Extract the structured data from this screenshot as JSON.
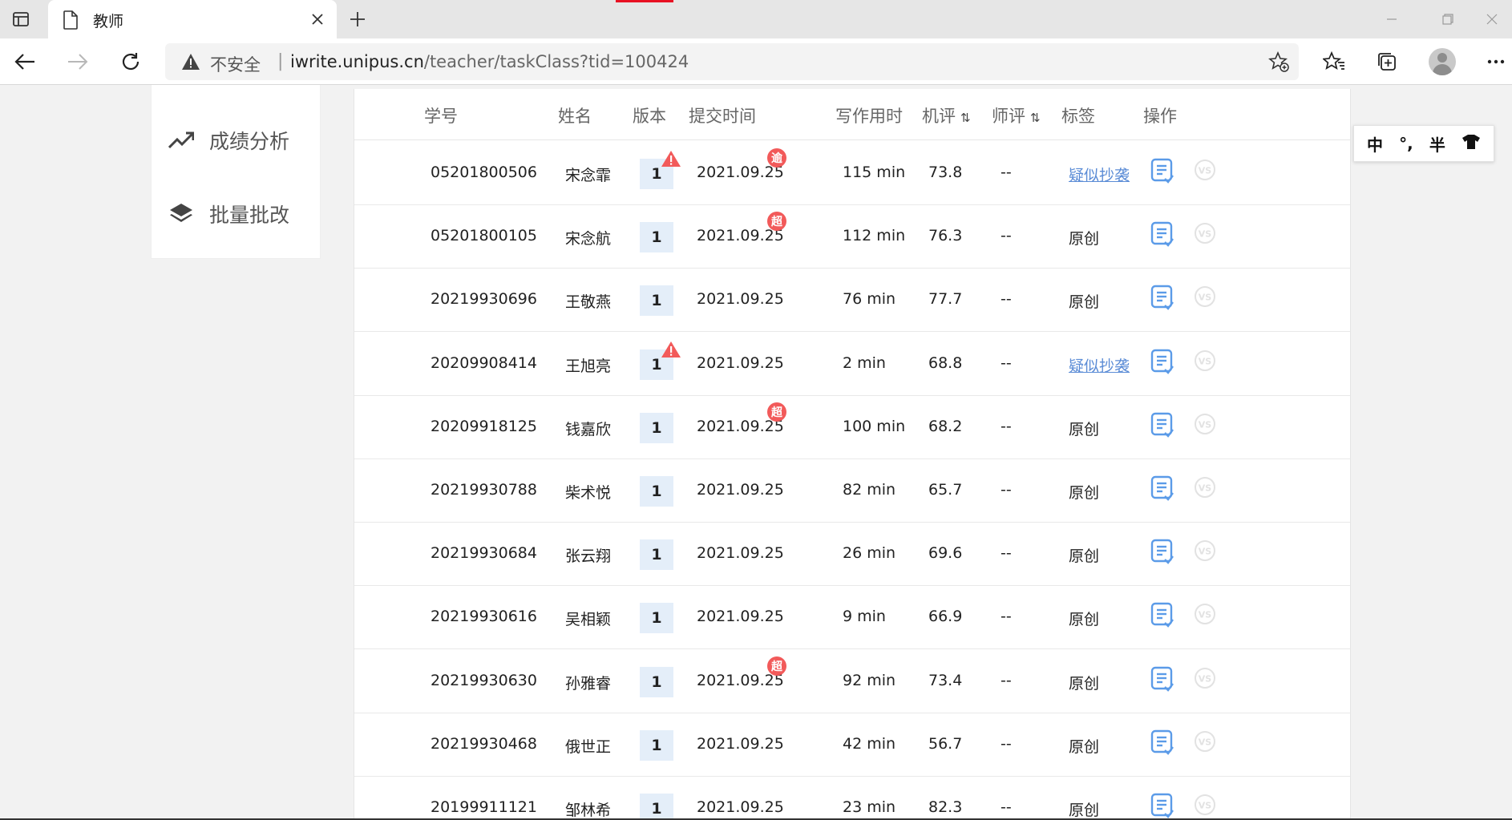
{
  "browser": {
    "tab_title": "教师",
    "insecure_label": "不安全",
    "url_host": "iwrite.unipus.cn",
    "url_path": "/teacher/taskClass?tid=100424"
  },
  "sidebar": {
    "items": [
      {
        "label": "成绩分析",
        "icon": "trend-icon"
      },
      {
        "label": "批量批改",
        "icon": "layers-icon"
      }
    ]
  },
  "table": {
    "headers": {
      "id": "学号",
      "name": "姓名",
      "version": "版本",
      "submit_time": "提交时间",
      "duration": "写作用时",
      "machine_score": "机评",
      "teacher_score": "师评",
      "tag": "标签",
      "action": "操作"
    },
    "rows": [
      {
        "id": "05201800506",
        "name": "宋念霏",
        "version": "1",
        "date": "2021.09.25",
        "duration": "115 min",
        "score": "73.8",
        "teacher": "--",
        "tag": "疑似抄袭",
        "tag_link": true,
        "warn": true,
        "badge": "逾"
      },
      {
        "id": "05201800105",
        "name": "宋念航",
        "version": "1",
        "date": "2021.09.25",
        "duration": "112 min",
        "score": "76.3",
        "teacher": "--",
        "tag": "原创",
        "tag_link": false,
        "warn": false,
        "badge": "超"
      },
      {
        "id": "20219930696",
        "name": "王敬燕",
        "version": "1",
        "date": "2021.09.25",
        "duration": "76 min",
        "score": "77.7",
        "teacher": "--",
        "tag": "原创",
        "tag_link": false,
        "warn": false,
        "badge": ""
      },
      {
        "id": "20209908414",
        "name": "王旭亮",
        "version": "1",
        "date": "2021.09.25",
        "duration": "2 min",
        "score": "68.8",
        "teacher": "--",
        "tag": "疑似抄袭",
        "tag_link": true,
        "warn": true,
        "badge": ""
      },
      {
        "id": "20209918125",
        "name": "钱嘉欣",
        "version": "1",
        "date": "2021.09.25",
        "duration": "100 min",
        "score": "68.2",
        "teacher": "--",
        "tag": "原创",
        "tag_link": false,
        "warn": false,
        "badge": "超"
      },
      {
        "id": "20219930788",
        "name": "柴术悦",
        "version": "1",
        "date": "2021.09.25",
        "duration": "82 min",
        "score": "65.7",
        "teacher": "--",
        "tag": "原创",
        "tag_link": false,
        "warn": false,
        "badge": ""
      },
      {
        "id": "20219930684",
        "name": "张云翔",
        "version": "1",
        "date": "2021.09.25",
        "duration": "26 min",
        "score": "69.6",
        "teacher": "--",
        "tag": "原创",
        "tag_link": false,
        "warn": false,
        "badge": ""
      },
      {
        "id": "20219930616",
        "name": "吴相颖",
        "version": "1",
        "date": "2021.09.25",
        "duration": "9 min",
        "score": "66.9",
        "teacher": "--",
        "tag": "原创",
        "tag_link": false,
        "warn": false,
        "badge": ""
      },
      {
        "id": "20219930630",
        "name": "孙雅睿",
        "version": "1",
        "date": "2021.09.25",
        "duration": "92 min",
        "score": "73.4",
        "teacher": "--",
        "tag": "原创",
        "tag_link": false,
        "warn": false,
        "badge": "超"
      },
      {
        "id": "20219930468",
        "name": "俄世正",
        "version": "1",
        "date": "2021.09.25",
        "duration": "42 min",
        "score": "56.7",
        "teacher": "--",
        "tag": "原创",
        "tag_link": false,
        "warn": false,
        "badge": ""
      },
      {
        "id": "20199911121",
        "name": "邹林希",
        "version": "1",
        "date": "2021.09.25",
        "duration": "23 min",
        "score": "82.3",
        "teacher": "--",
        "tag": "原创",
        "tag_link": false,
        "warn": false,
        "badge": ""
      }
    ]
  },
  "ime": {
    "items": [
      "中",
      "°,",
      "半",
      "shirt-icon"
    ]
  },
  "colors": {
    "link": "#5b8cd6",
    "version_bg": "#e4eef9",
    "badge_red": "#f25a5a",
    "icon_blue": "#5b9be8"
  }
}
